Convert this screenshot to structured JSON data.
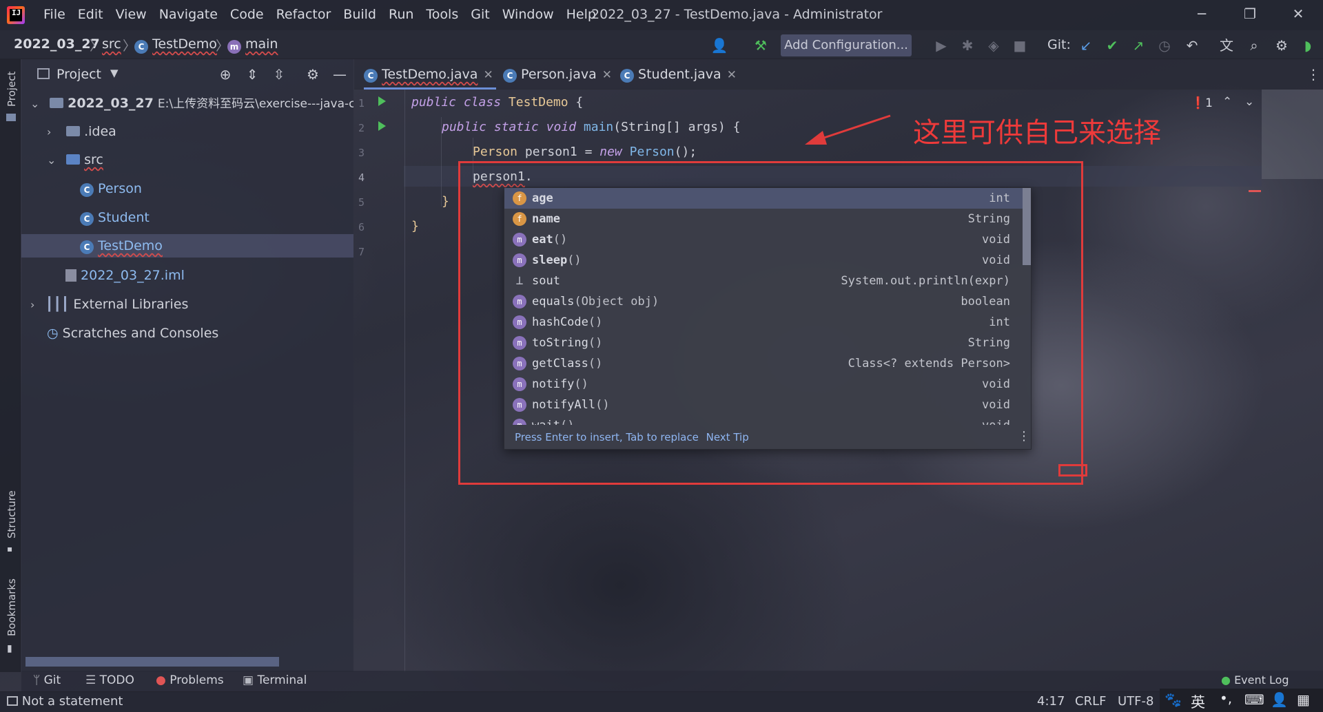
{
  "app": {
    "menu": [
      "File",
      "Edit",
      "View",
      "Navigate",
      "Code",
      "Refactor",
      "Build",
      "Run",
      "Tools",
      "Git",
      "Window",
      "Help"
    ],
    "window_title": "2022_03_27 - TestDemo.java - Administrator"
  },
  "breadcrumb": {
    "project": "2022_03_27",
    "src": "src",
    "file": "TestDemo",
    "method": "main"
  },
  "toolbar": {
    "add_configuration": "Add Configuration...",
    "git_label": "Git:"
  },
  "side_labels": {
    "project": "Project",
    "structure": "Structure",
    "bookmarks": "Bookmarks"
  },
  "project_panel": {
    "title": "Project",
    "root_name": "2022_03_27",
    "root_path": "E:\\上传资料至码云\\exercise---java-cc",
    "idea": ".idea",
    "src": "src",
    "person": "Person",
    "student": "Student",
    "testdemo": "TestDemo",
    "iml": "2022_03_27.iml",
    "external_libraries": "External Libraries",
    "scratches": "Scratches and Consoles"
  },
  "tabs": [
    "TestDemo.java",
    "Person.java",
    "Student.java"
  ],
  "editor": {
    "line_numbers": [
      "1",
      "2",
      "3",
      "4",
      "5",
      "6",
      "7"
    ],
    "line1_kw": "public class ",
    "line1_name": "TestDemo",
    "line1_rest": " {",
    "line2_kw": "public static void ",
    "line2_fn": "main",
    "line2_rest": "(String[] args) {",
    "line3_type": "Person",
    "line3_mid": " person1 = ",
    "line3_kw": "new ",
    "line3_fn": "Person",
    "line3_rest": "();",
    "line4_var": "person1",
    "line4_dot": ".",
    "line5": "}",
    "line6": "}",
    "error_count": "1"
  },
  "popup": {
    "items": [
      {
        "icon": "f",
        "name": "age",
        "params": "",
        "type": "int"
      },
      {
        "icon": "f",
        "name": "name",
        "params": "",
        "type": "String"
      },
      {
        "icon": "m",
        "name": "eat",
        "params": "()",
        "type": "void"
      },
      {
        "icon": "m",
        "name": "sleep",
        "params": "()",
        "type": "void"
      },
      {
        "icon": "t",
        "name": "sout",
        "params": "",
        "type": "System.out.println(expr)"
      },
      {
        "icon": "m",
        "name": "equals",
        "params": "(Object obj)",
        "type": "boolean"
      },
      {
        "icon": "m",
        "name": "hashCode",
        "params": "()",
        "type": "int"
      },
      {
        "icon": "m",
        "name": "toString",
        "params": "()",
        "type": "String"
      },
      {
        "icon": "m",
        "name": "getClass",
        "params": "()",
        "type": "Class<? extends Person>"
      },
      {
        "icon": "m",
        "name": "notify",
        "params": "()",
        "type": "void"
      },
      {
        "icon": "m",
        "name": "notifyAll",
        "params": "()",
        "type": "void"
      },
      {
        "icon": "m",
        "name": "wait",
        "params": "()",
        "type": "void"
      }
    ],
    "footer": "Press Enter to insert, Tab to replace",
    "next_tip": "Next Tip"
  },
  "annotation": {
    "text": "这里可供自己来选择",
    "color": "#e03b3b"
  },
  "bottom_tools": {
    "git": "Git",
    "todo": "TODO",
    "problems": "Problems",
    "terminal": "Terminal",
    "event_log": "Event Log"
  },
  "status": {
    "message": "Not a statement",
    "position": "4:17",
    "line_sep": "CRLF",
    "encoding": "UTF-8",
    "ime": "英"
  }
}
